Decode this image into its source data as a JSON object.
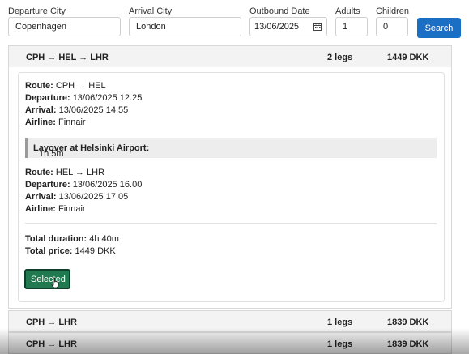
{
  "search_form": {
    "departure_label": "Departure City",
    "departure_value": "Copenhagen",
    "arrival_label": "Arrival City",
    "arrival_value": "London",
    "outbound_label": "Outbound Date",
    "outbound_value": "13/06/2025",
    "adults_label": "Adults",
    "adults_value": "1",
    "children_label": "Children",
    "children_value": "0",
    "search_button": "Search",
    "calendar_icon": "calendar-icon",
    "accent_color": "#1a6fc4"
  },
  "results": [
    {
      "route": "CPH → HEL → LHR",
      "legs": "2 legs",
      "price": "1449 DKK",
      "expanded": true,
      "segments": [
        {
          "route_label": "Route:",
          "route": "CPH → HEL",
          "departure_label": "Departure:",
          "departure": "13/06/2025 12.25",
          "arrival_label": "Arrival:",
          "arrival": "13/06/2025 14.55",
          "airline_label": "Airline:",
          "airline": "Finnair"
        },
        {
          "route_label": "Route:",
          "route": "HEL → LHR",
          "departure_label": "Departure:",
          "departure": "13/06/2025 16.00",
          "arrival_label": "Arrival:",
          "arrival": "13/06/2025 17.05",
          "airline_label": "Airline:",
          "airline": "Finnair"
        }
      ],
      "layover_label": "Layover at Helsinki Airport:",
      "layover_duration": "1h 5m",
      "total_duration_label": "Total duration:",
      "total_duration": "4h 40m",
      "total_price_label": "Total price:",
      "total_price": "1449 DKK",
      "selected_button": "Selected",
      "selected_color": "#217a4f"
    },
    {
      "route": "CPH → LHR",
      "legs": "1 legs",
      "price": "1839 DKK"
    },
    {
      "route": "CPH → LHR",
      "legs": "1 legs",
      "price": "1839 DKK"
    }
  ]
}
